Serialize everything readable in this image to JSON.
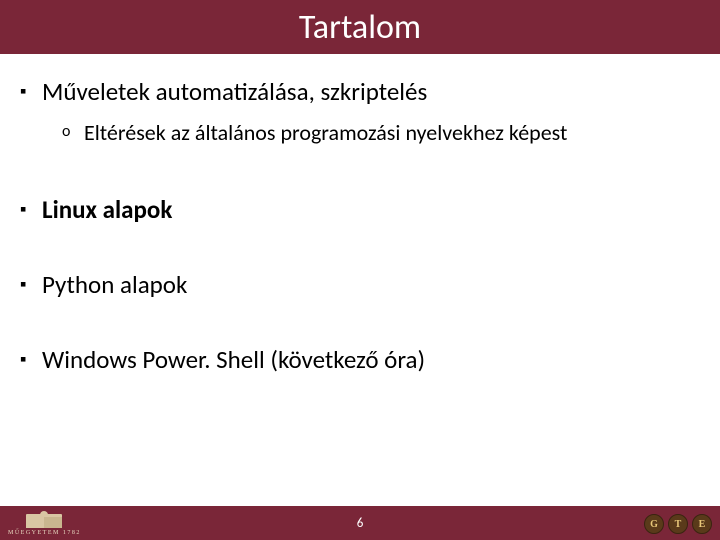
{
  "title": "Tartalom",
  "bullets": {
    "b0": {
      "text": "Műveletek automatizálása, szkriptelés",
      "sub": "Eltérések az általános programozási nyelvekhez képest"
    },
    "b1": {
      "text": "Linux alapok"
    },
    "b2": {
      "text": "Python alapok"
    },
    "b3": {
      "text": "Windows Power. Shell (következő óra)"
    }
  },
  "footer": {
    "page": "6",
    "left_text": "MŰEGYETEM 1782",
    "badges": {
      "g": "G",
      "t": "T",
      "e": "E"
    }
  }
}
